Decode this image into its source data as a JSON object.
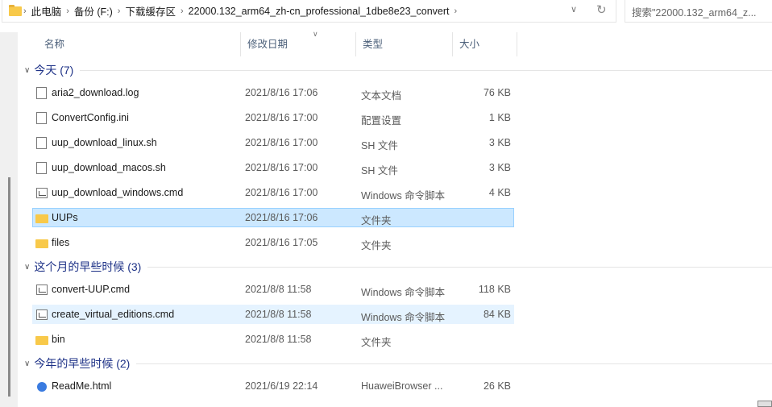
{
  "address": {
    "crumbs": [
      "此电脑",
      "备份 (F:)",
      "下载缓存区",
      "22000.132_arm64_zh-cn_professional_1dbe8e23_convert"
    ]
  },
  "search": {
    "placeholder": "搜索\"22000.132_arm64_z..."
  },
  "columns": {
    "name": "名称",
    "date": "修改日期",
    "type": "类型",
    "size": "大小"
  },
  "groups": [
    {
      "title": "今天 (7)",
      "items": [
        {
          "name": "aria2_download.log",
          "date": "2021/8/16 17:06",
          "type": "文本文档",
          "size": "76 KB",
          "icon": "text-file-icon"
        },
        {
          "name": "ConvertConfig.ini",
          "date": "2021/8/16 17:00",
          "type": "配置设置",
          "size": "1 KB",
          "icon": "settings-file-icon"
        },
        {
          "name": "uup_download_linux.sh",
          "date": "2021/8/16 17:00",
          "type": "SH 文件",
          "size": "3 KB",
          "icon": "file-icon"
        },
        {
          "name": "uup_download_macos.sh",
          "date": "2021/8/16 17:00",
          "type": "SH 文件",
          "size": "3 KB",
          "icon": "file-icon"
        },
        {
          "name": "uup_download_windows.cmd",
          "date": "2021/8/16 17:00",
          "type": "Windows 命令脚本",
          "size": "4 KB",
          "icon": "cmd-icon"
        },
        {
          "name": "UUPs",
          "date": "2021/8/16 17:06",
          "type": "文件夹",
          "size": "",
          "icon": "folder-icon"
        },
        {
          "name": "files",
          "date": "2021/8/16 17:05",
          "type": "文件夹",
          "size": "",
          "icon": "folder-icon"
        }
      ]
    },
    {
      "title": "这个月的早些时候 (3)",
      "items": [
        {
          "name": "convert-UUP.cmd",
          "date": "2021/8/8 11:58",
          "type": "Windows 命令脚本",
          "size": "118 KB",
          "icon": "cmd-icon"
        },
        {
          "name": "create_virtual_editions.cmd",
          "date": "2021/8/8 11:58",
          "type": "Windows 命令脚本",
          "size": "84 KB",
          "icon": "cmd-icon"
        },
        {
          "name": "bin",
          "date": "2021/8/8 11:58",
          "type": "文件夹",
          "size": "",
          "icon": "folder-icon"
        }
      ]
    },
    {
      "title": "今年的早些时候 (2)",
      "items": [
        {
          "name": "ReadMe.html",
          "date": "2021/6/19 22:14",
          "type": "HuaweiBrowser ...",
          "size": "26 KB",
          "icon": "browser-html-icon"
        }
      ]
    }
  ]
}
